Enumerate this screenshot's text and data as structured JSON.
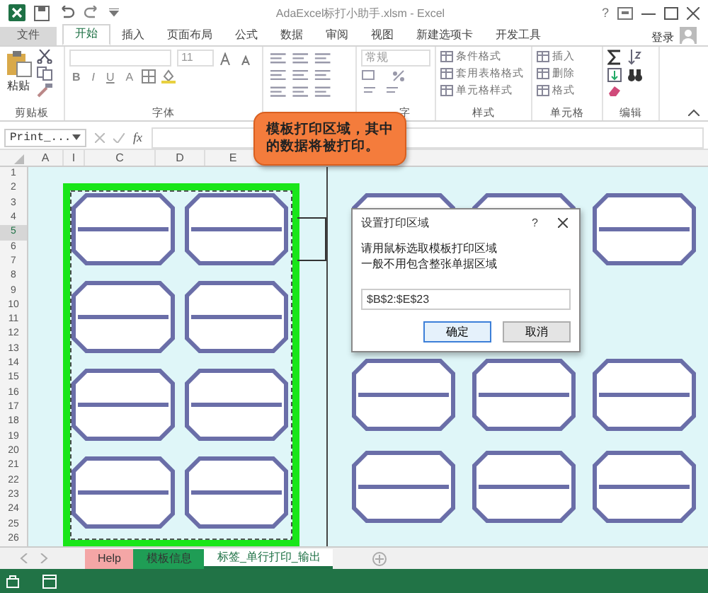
{
  "window": {
    "title": "AdaExcel标打小助手.xlsm - Excel",
    "help": "?"
  },
  "ribbon_tabs": [
    {
      "label": "文件",
      "selected": false
    },
    {
      "label": "开始",
      "selected": true
    },
    {
      "label": "插入",
      "selected": false
    },
    {
      "label": "页面布局",
      "selected": false
    },
    {
      "label": "公式",
      "selected": false
    },
    {
      "label": "数据",
      "selected": false
    },
    {
      "label": "审阅",
      "selected": false
    },
    {
      "label": "视图",
      "selected": false
    },
    {
      "label": "新建选项卡",
      "selected": false
    },
    {
      "label": "开发工具",
      "selected": false
    }
  ],
  "sign_in": "登录",
  "ribbon_groups": [
    {
      "kind": "clipboard",
      "name": "剪贴板",
      "items": [
        "粘贴"
      ]
    },
    {
      "kind": "font",
      "name": "字体",
      "items": [
        "11",
        "B",
        "I",
        "U",
        "A"
      ]
    },
    {
      "kind": "alignment"
    },
    {
      "kind": "number",
      "name": "字",
      "items": [
        "常规"
      ]
    },
    {
      "kind": "list",
      "name": "样式",
      "items": [
        "条件格式",
        "套用表格格式",
        "单元格样式"
      ]
    },
    {
      "kind": "list",
      "name": "单元格",
      "items": [
        "插入",
        "删除",
        "格式"
      ]
    },
    {
      "kind": "editing",
      "name": "编辑"
    }
  ],
  "name_box": "Print_...",
  "fx": "fx",
  "columns": [
    "A",
    "I",
    "C",
    "D",
    "E"
  ],
  "rows": [
    {
      "label": "1",
      "selected": false
    },
    {
      "label": "2",
      "selected": false
    },
    {
      "label": "3",
      "selected": false
    },
    {
      "label": "4",
      "selected": false
    },
    {
      "label": "5",
      "selected": true
    },
    {
      "label": "6",
      "selected": false
    },
    {
      "label": "7",
      "selected": false
    },
    {
      "label": "8",
      "selected": false
    },
    {
      "label": "9",
      "selected": false
    },
    {
      "label": "10",
      "selected": false
    },
    {
      "label": "11",
      "selected": false
    },
    {
      "label": "12",
      "selected": false
    },
    {
      "label": "13",
      "selected": false
    },
    {
      "label": "14",
      "selected": false
    },
    {
      "label": "15",
      "selected": false
    },
    {
      "label": "16",
      "selected": false
    },
    {
      "label": "17",
      "selected": false
    },
    {
      "label": "18",
      "selected": false
    },
    {
      "label": "19",
      "selected": false
    },
    {
      "label": "20",
      "selected": false
    },
    {
      "label": "21",
      "selected": false
    },
    {
      "label": "22",
      "selected": false
    },
    {
      "label": "23",
      "selected": false
    },
    {
      "label": "24",
      "selected": false
    },
    {
      "label": "25",
      "selected": false
    },
    {
      "label": "26",
      "selected": false
    }
  ],
  "callout": "模板打印区域，其中的数据将被打印。",
  "dialog": {
    "title": "设置打印区域",
    "help": "?",
    "message_lines": [
      "请用鼠标选取模板打印区域",
      "一般不用包含整张单据区域"
    ],
    "value": "$B$2:$E$23",
    "buttons": [
      {
        "label": "确定",
        "default": true
      },
      {
        "label": "取消",
        "default": false
      }
    ]
  },
  "sheet_tabs": [
    {
      "label": "Help",
      "color": "#f4a6a6",
      "selected": false
    },
    {
      "label": "模板信息",
      "color": "#1f9d55",
      "selected": false
    },
    {
      "label": "标签_单行打印_输出",
      "selected": true
    }
  ]
}
